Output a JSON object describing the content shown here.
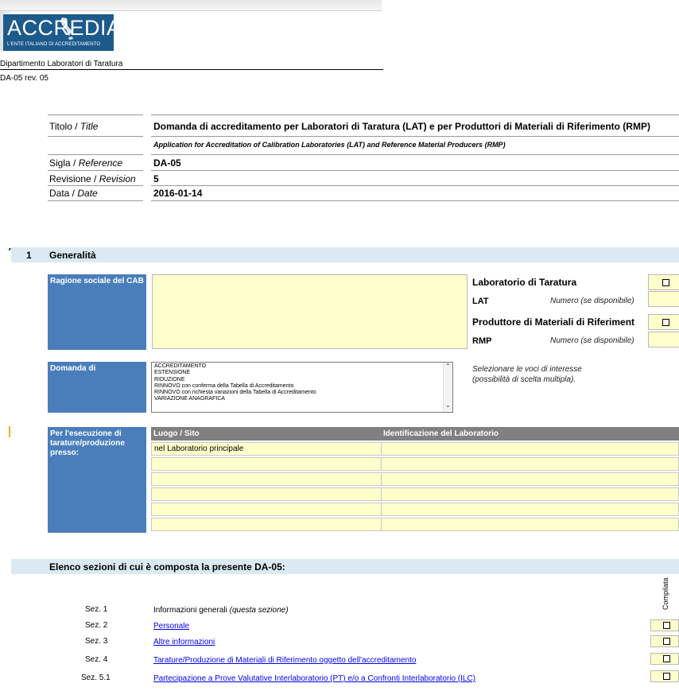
{
  "logo": {
    "word": "ACCREDIA",
    "subtitle": "L'ENTE ITALIANO DI ACCREDITAMENTO"
  },
  "department": "Dipartimento Laboratori di Taratura",
  "doc_rev": "DA-05 rev. 05",
  "header": {
    "title_label": "Titolo / ",
    "title_label_en": "Title",
    "title_value": "Domanda di accreditamento per Laboratori di Taratura (LAT) e per Produttori di Materiali di Riferimento (RMP)",
    "title_sub": "Application for Accreditation of Calibration Laboratories (LAT) and Reference Material Producers (RMP)",
    "ref_label": "Sigla / ",
    "ref_label_en": "Reference",
    "ref_value": "DA-05",
    "rev_label": "Revisione / ",
    "rev_label_en": "Revision",
    "rev_value": "5",
    "date_label": "Data / ",
    "date_label_en": "Date",
    "date_value": "2016-01-14"
  },
  "section1": {
    "number": "1",
    "title": "Generalità",
    "ragione_sociale": "Ragione sociale del CAB",
    "lat_title": "Laboratorio di Taratura",
    "lat_code": "LAT",
    "lat_numero": "Numero (se disponibile)",
    "rmp_title": "Produttore di Materiali di Riferiment",
    "rmp_code": "RMP",
    "rmp_numero": "Numero (se disponibile)",
    "domanda_di": "Domanda di",
    "domanda_options": [
      "ACCREDITAMENTO",
      "ESTENSIONE",
      "RIDUZIONE",
      "RINNOVO con conferma della Tabella di Accreditamento",
      "RINNOVO con richiesta variazioni della Tabella di Accreditamento",
      "VARIAZIONE ANAGRAFICA"
    ],
    "selezionare_line1": "Selezionare le voci di interesse",
    "selezionare_line2": "(possibilità di scelta multipla).",
    "esecuzione": "Per l'esecuzione di tarature/produzione presso:",
    "col_luogo": "Luogo / Sito",
    "col_ident": "Identificazione del Laboratorio",
    "first_row": "nel Laboratorio principale"
  },
  "elenco": {
    "title": "Elenco sezioni di cui è composta la presente DA-05:",
    "compilata": "Compilata",
    "rows": [
      {
        "sez": "Sez. 1",
        "text": "Informazioni generali ",
        "italic": "(questa sezione)",
        "link": false
      },
      {
        "sez": "Sez. 2",
        "text": "Personale",
        "italic": "",
        "link": true
      },
      {
        "sez": "Sez. 3",
        "text": "Altre informazioni",
        "italic": "",
        "link": true
      },
      {
        "sez": "Sez. 4",
        "text": "Tarature/Produzione di Materiali di Riferimento oggetto dell'accreditamento",
        "italic": "",
        "link": true
      },
      {
        "sez": "Sez. 5.1",
        "text": "Partecipazione a Prove Valutative Interlaboratorio (PT) e/o a Confronti Interlaboratorio (ILC)",
        "italic": "",
        "link": true
      }
    ]
  },
  "colors": {
    "band": "#dbeaf2",
    "blue": "#4a7ebb",
    "yellow": "#ffffcc",
    "logo": "#1d5a8c"
  }
}
